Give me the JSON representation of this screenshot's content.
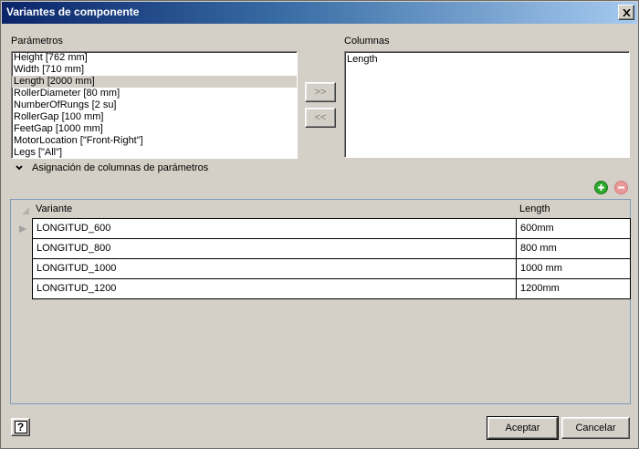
{
  "window": {
    "title": "Variantes de componente"
  },
  "parameters": {
    "label": "Parámetros",
    "items": [
      {
        "label": "Height [762 mm]",
        "selected": false
      },
      {
        "label": "Width [710 mm]",
        "selected": false
      },
      {
        "label": "Length [2000 mm]",
        "selected": true
      },
      {
        "label": "RollerDiameter [80 mm]",
        "selected": false
      },
      {
        "label": "NumberOfRungs [2 su]",
        "selected": false
      },
      {
        "label": "RollerGap [100 mm]",
        "selected": false
      },
      {
        "label": "FeetGap [1000 mm]",
        "selected": false
      },
      {
        "label": "MotorLocation [\"Front-Right\"]",
        "selected": false
      },
      {
        "label": "Legs [\"All\"]",
        "selected": false
      }
    ]
  },
  "transfer": {
    "add_label": ">>",
    "remove_label": "<<"
  },
  "columns": {
    "label": "Columnas",
    "items": [
      {
        "label": "Length"
      }
    ]
  },
  "mapping": {
    "label": "Asignación de columnas de parámetros"
  },
  "grid": {
    "headers": {
      "variant": "Variante",
      "length": "Length"
    },
    "rows": [
      {
        "variant": "LONGITUD_600",
        "length": "600mm"
      },
      {
        "variant": "LONGITUD_800",
        "length": "800 mm"
      },
      {
        "variant": "LONGITUD_1000",
        "length": "1000 mm"
      },
      {
        "variant": "LONGITUD_1200",
        "length": "1200mm"
      }
    ]
  },
  "footer": {
    "help_icon": "?",
    "ok_label": "Aceptar",
    "cancel_label": "Cancelar"
  },
  "colors": {
    "add_row": "#2ea82e",
    "remove_row": "#e89a9a",
    "title_start": "#0a246a",
    "title_end": "#a6caf0"
  }
}
